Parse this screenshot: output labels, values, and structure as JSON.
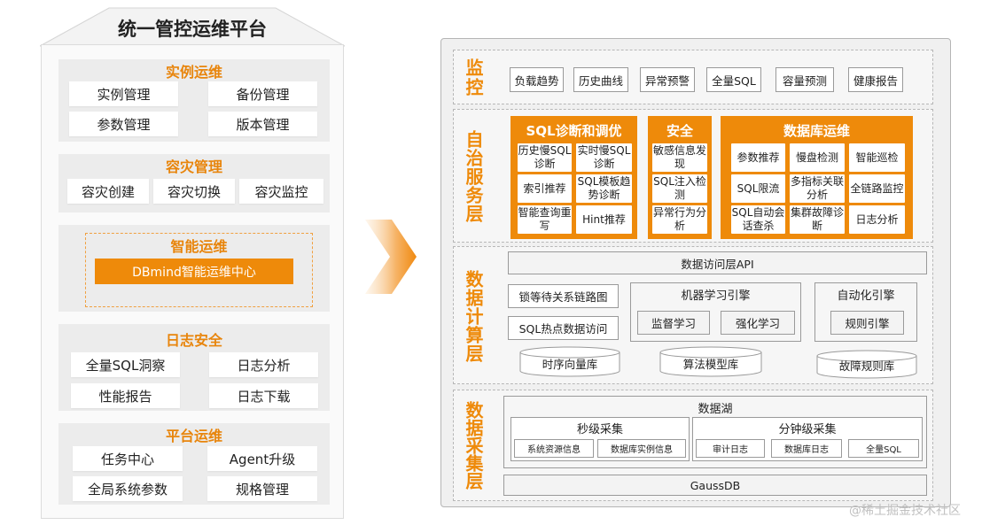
{
  "platform": {
    "title": "统一管控运维平台",
    "sections": [
      {
        "title": "实例运维",
        "items": [
          "实例管理",
          "备份管理",
          "参数管理",
          "版本管理"
        ]
      },
      {
        "title": "容灾管理",
        "items": [
          "容灾创建",
          "容灾切换",
          "容灾监控"
        ]
      },
      {
        "title": "智能运维",
        "button": "DBmind智能运维中心"
      },
      {
        "title": "日志安全",
        "items": [
          "全量SQL洞察",
          "日志分析",
          "性能报告",
          "日志下载"
        ]
      },
      {
        "title": "平台运维",
        "items": [
          "任务中心",
          "Agent升级",
          "全局系统参数",
          "规格管理"
        ]
      }
    ]
  },
  "monitor": {
    "label": "监控",
    "items": [
      "负载趋势",
      "历史曲线",
      "异常预警",
      "全量SQL",
      "容量预测",
      "健康报告"
    ]
  },
  "autonomous": {
    "label": "自治服务层",
    "sql_group": {
      "title": "SQL诊断和调优",
      "items": [
        "历史慢SQL诊断",
        "实时慢SQL诊断",
        "索引推荐",
        "SQL模板趋势诊断",
        "智能查询重写",
        "Hint推荐"
      ]
    },
    "security_group": {
      "title": "安全",
      "items": [
        "敏感信息发现",
        "SQL注入检测",
        "异常行为分析"
      ]
    },
    "db_ops_group": {
      "title": "数据库运维",
      "items": [
        "参数推荐",
        "慢盘检测",
        "智能巡检",
        "SQL限流",
        "多指标关联分析",
        "全链路监控",
        "SQL自动会话查杀",
        "集群故障诊断",
        "日志分析"
      ]
    }
  },
  "compute": {
    "label": "数据计算层",
    "api": "数据访问层API",
    "lock_chain": "锁等待关系链路图",
    "sql_hot": "SQL热点数据访问",
    "ml_engine": {
      "title": "机器学习引擎",
      "items": [
        "监督学习",
        "强化学习"
      ]
    },
    "auto_engine": {
      "title": "自动化引擎",
      "items": [
        "规则引擎"
      ]
    },
    "stores": [
      "时序向量库",
      "算法模型库",
      "故障规则库"
    ]
  },
  "collect": {
    "label": "数据采集层",
    "lake": "数据湖",
    "second_level": {
      "title": "秒级采集",
      "items": [
        "系统资源信息",
        "数据库实例信息"
      ]
    },
    "minute_level": {
      "title": "分钟级采集",
      "items": [
        "审计日志",
        "数据库日志",
        "全量SQL"
      ]
    },
    "gaussdb": "GaussDB"
  },
  "watermark": "@稀土掘金技术社区"
}
